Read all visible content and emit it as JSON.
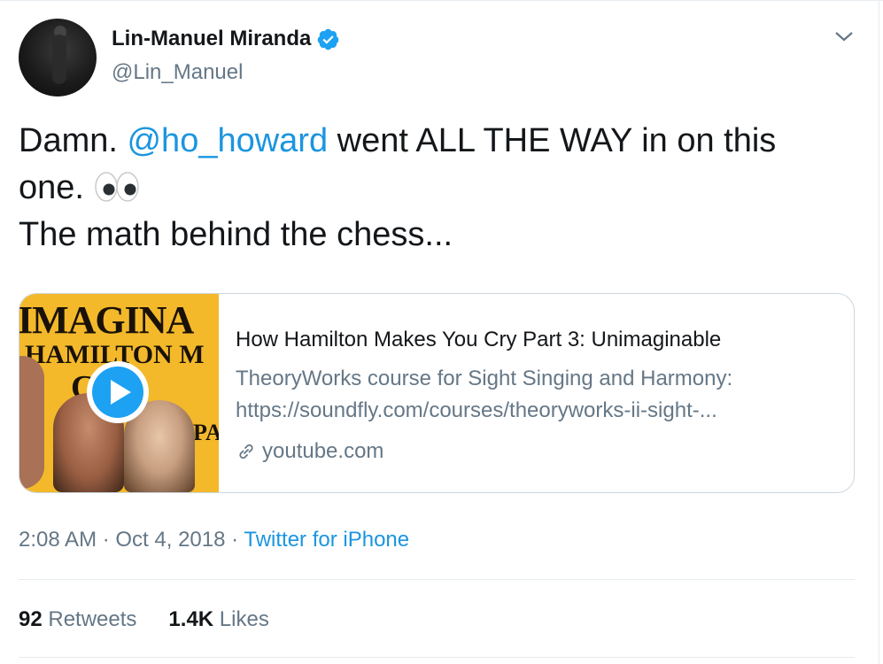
{
  "author": {
    "name": "Lin-Manuel Miranda",
    "handle": "@Lin_Manuel",
    "verified": true
  },
  "tweet": {
    "text_before_mention": "Damn. ",
    "mention": "@ho_howard",
    "text_after_mention": " went ALL THE WAY in on this one. ",
    "emoji": "eyes",
    "line2": "The math behind the chess..."
  },
  "card": {
    "thumbnail_text": [
      "IMAGINA",
      "HAMILTON M",
      "CRY",
      "PA"
    ],
    "title": "How Hamilton Makes You Cry Part 3: Unimaginable",
    "description_line1": "TheoryWorks course for Sight Singing and Harmony:",
    "description_line2": "https://soundfly.com/courses/theoryworks-ii-sight-...",
    "domain": "youtube.com"
  },
  "meta": {
    "time": "2:08 AM",
    "separator": " · ",
    "date": "Oct 4, 2018",
    "source": "Twitter for iPhone"
  },
  "stats": {
    "retweets_count": "92",
    "retweets_label": "Retweets",
    "likes_count": "1.4K",
    "likes_label": "Likes"
  },
  "colors": {
    "link_blue": "#1b95e0",
    "secondary_text": "#657786",
    "primary_text": "#14171a",
    "verified_blue": "#1da1f2"
  },
  "icons": [
    "verified-badge-icon",
    "chevron-down-icon",
    "play-icon",
    "link-icon",
    "eyes-emoji-icon"
  ]
}
